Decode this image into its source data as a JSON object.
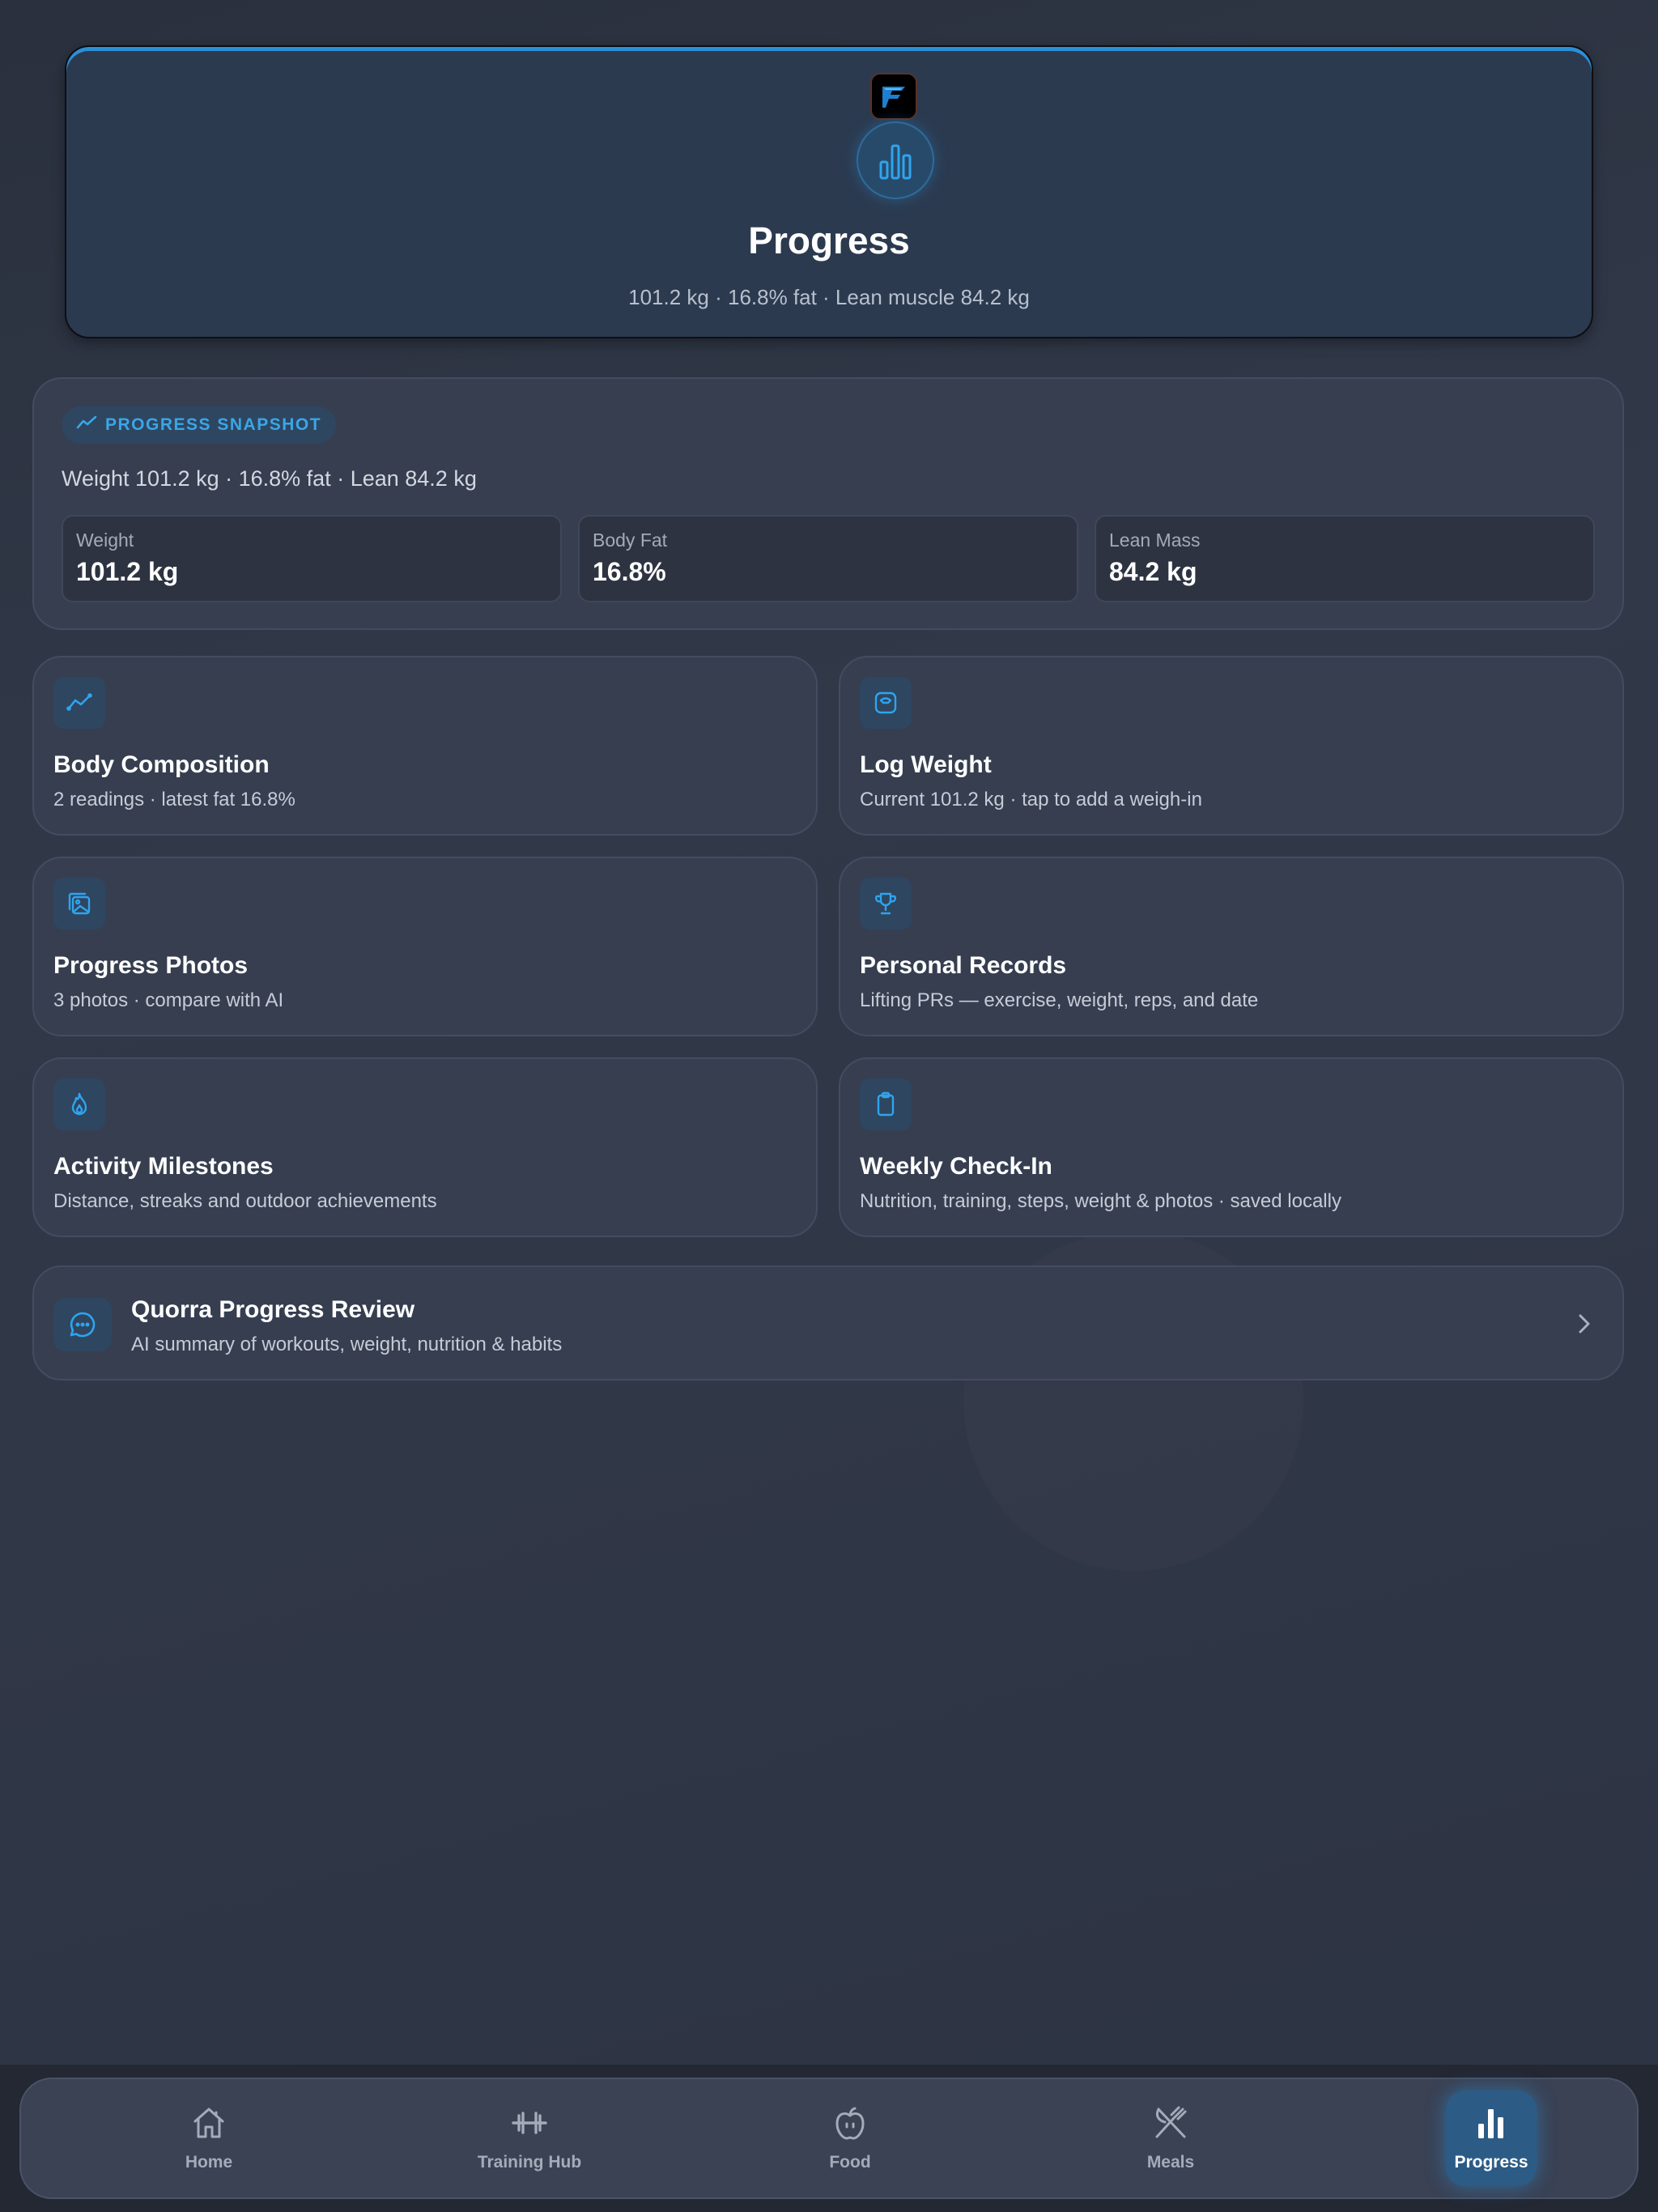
{
  "colors": {
    "accent": "#2b9de6",
    "background": "#2f3646",
    "card": "#363e50"
  },
  "header": {
    "logo_icon": "app-logo-icon",
    "icon": "bar-chart-icon",
    "title": "Progress",
    "subtitle": "101.2 kg · 16.8% fat · Lean muscle 84.2 kg"
  },
  "snapshot": {
    "badge_icon": "trend-line-icon",
    "badge": "PROGRESS SNAPSHOT",
    "summary": "Weight 101.2 kg · 16.8% fat · Lean 84.2 kg",
    "stats": [
      {
        "label": "Weight",
        "value": "101.2 kg"
      },
      {
        "label": "Body Fat",
        "value": "16.8%"
      },
      {
        "label": "Lean Mass",
        "value": "84.2 kg"
      }
    ]
  },
  "cards": [
    {
      "icon": "trend-line-icon",
      "title": "Body Composition",
      "subtitle": "2 readings · latest fat 16.8%"
    },
    {
      "icon": "scale-icon",
      "title": "Log Weight",
      "subtitle": "Current 101.2 kg · tap to add a weigh-in"
    },
    {
      "icon": "photos-icon",
      "title": "Progress Photos",
      "subtitle": "3 photos · compare with AI"
    },
    {
      "icon": "trophy-icon",
      "title": "Personal Records",
      "subtitle": "Lifting PRs — exercise, weight, reps, and date"
    },
    {
      "icon": "flame-icon",
      "title": "Activity Milestones",
      "subtitle": "Distance, streaks and outdoor achievements"
    },
    {
      "icon": "clipboard-icon",
      "title": "Weekly Check-In",
      "subtitle": "Nutrition, training, steps, weight & photos · saved locally"
    }
  ],
  "review": {
    "icon": "chat-bubble-icon",
    "title": "Quorra Progress Review",
    "subtitle": "AI summary of workouts, weight, nutrition & habits"
  },
  "nav": {
    "items": [
      {
        "label": "Home",
        "icon": "home-icon"
      },
      {
        "label": "Training Hub",
        "icon": "dumbbell-icon"
      },
      {
        "label": "Food",
        "icon": "apple-icon"
      },
      {
        "label": "Meals",
        "icon": "utensils-icon"
      },
      {
        "label": "Progress",
        "icon": "bar-chart-icon",
        "active": true
      }
    ]
  }
}
